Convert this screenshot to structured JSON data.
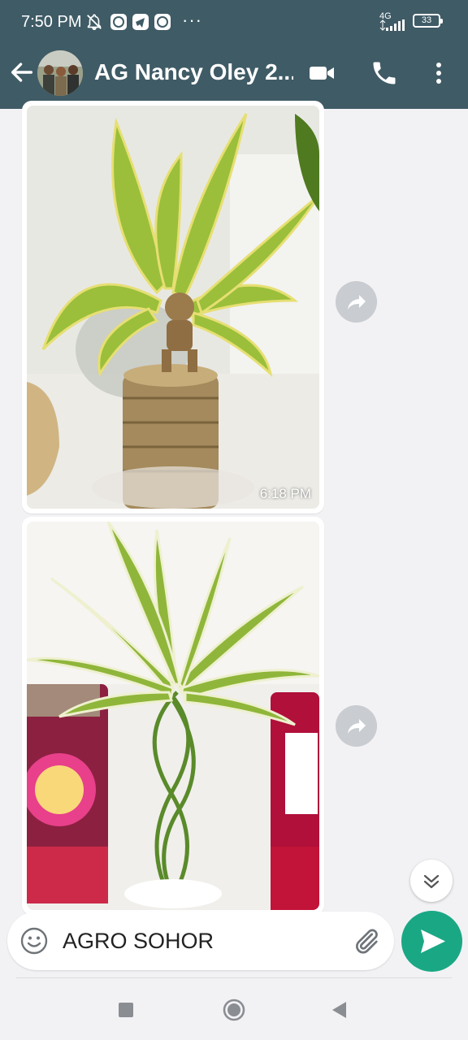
{
  "status_bar": {
    "time": "7:50 PM",
    "network": "4G",
    "battery": "33",
    "overflow": "···"
  },
  "app_bar": {
    "title": "AG Nancy Oley 2...",
    "icons": [
      "back-arrow-icon",
      "video-call-icon",
      "phone-call-icon",
      "more-vert-icon"
    ]
  },
  "messages": [
    {
      "type": "image",
      "subject": "plant-with-groot-figure",
      "time": "6:18 PM"
    },
    {
      "type": "image",
      "subject": "braided-plant-with-candles",
      "time": ""
    }
  ],
  "composer": {
    "value": "AGRO SOHOR",
    "icons": [
      "emoji-icon",
      "attach-icon",
      "send-icon"
    ]
  },
  "colors": {
    "app_bar": "#3f5b66",
    "send_button": "#1aa884",
    "chat_background": "#f2f2f5"
  }
}
